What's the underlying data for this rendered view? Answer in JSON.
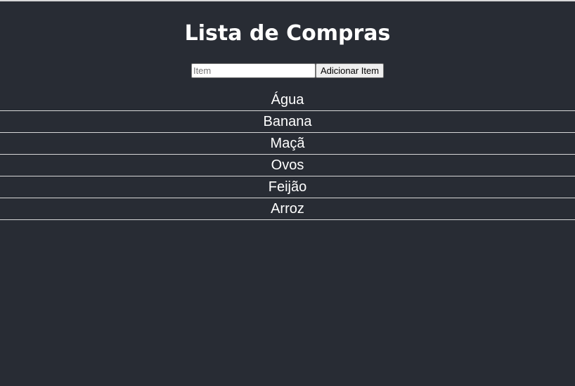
{
  "header": {
    "title": "Lista de Compras"
  },
  "form": {
    "input_placeholder": "Item",
    "input_value": "",
    "add_button_label": "Adicionar Item"
  },
  "list": {
    "items": [
      {
        "label": "Água"
      },
      {
        "label": "Banana"
      },
      {
        "label": "Maçã"
      },
      {
        "label": "Ovos"
      },
      {
        "label": "Feijão"
      },
      {
        "label": "Arroz"
      }
    ]
  },
  "colors": {
    "background": "#282c34",
    "text": "#ffffff",
    "divider": "#d8d8d8"
  }
}
